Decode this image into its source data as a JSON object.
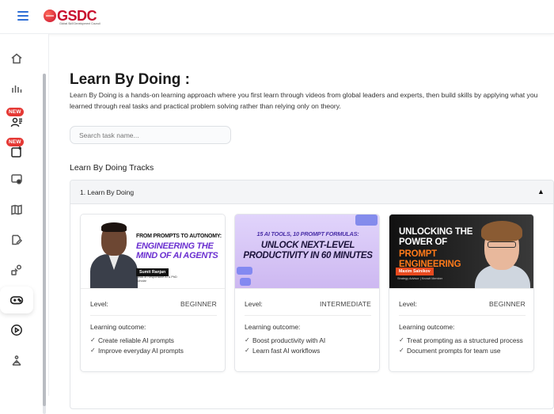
{
  "header": {
    "logo_text": "GSDC",
    "logo_sub": "Global Skill Development Council"
  },
  "sidebar": {
    "items": [
      {
        "name": "home",
        "icon": "home-icon"
      },
      {
        "name": "analytics",
        "icon": "bar-chart-icon"
      },
      {
        "name": "new-users",
        "icon": "users-icon",
        "badge": "NEW"
      },
      {
        "name": "new-add",
        "icon": "add-card-icon",
        "badge": "NEW"
      },
      {
        "name": "settings-card",
        "icon": "gear-card-icon"
      },
      {
        "name": "book",
        "icon": "book-icon"
      },
      {
        "name": "edit",
        "icon": "edit-icon"
      },
      {
        "name": "shapes",
        "icon": "shapes-icon"
      },
      {
        "name": "learn-by-doing",
        "icon": "gamepad-icon",
        "active": true
      },
      {
        "name": "video",
        "icon": "play-icon"
      },
      {
        "name": "network",
        "icon": "network-icon"
      }
    ]
  },
  "page": {
    "title": "Learn By Doing :",
    "description": "Learn By Doing is a hands-on learning approach where you first learn through videos from global leaders and experts, then build skills by applying what you learned through real tasks and practical problem solving rather than relying only on theory.",
    "search_placeholder": "Search task name...",
    "section_title": "Learn By Doing Tracks"
  },
  "accordion": {
    "title": "1. Learn By Doing",
    "arrow": "▲"
  },
  "cards": [
    {
      "thumb": {
        "line1": "FROM PROMPTS TO AUTONOMY:",
        "line2": "ENGINEERING THE MIND OF AI AGENTS",
        "badge": "Sumit Ranjan",
        "sub": "Head of Responsible AI & PhD Scholar"
      },
      "level_label": "Level:",
      "level": "BEGINNER",
      "outcome_title": "Learning outcome:",
      "outcomes": [
        "Create reliable AI prompts",
        "Improve everyday AI prompts"
      ]
    },
    {
      "thumb": {
        "line1": "15 AI TOOLS, 10 PROMPT FORMULAS:",
        "line2": "UNLOCK NEXT-LEVEL PRODUCTIVITY IN 60 MINUTES"
      },
      "level_label": "Level:",
      "level": "INTERMEDIATE",
      "outcome_title": "Learning outcome:",
      "outcomes": [
        "Boost productivity with AI",
        "Learn fast AI workflows"
      ]
    },
    {
      "thumb": {
        "line1": "UNLOCKING THE POWER OF",
        "line2": "PROMPT ENGINEERING",
        "badge": "Maxim Salnikov",
        "sub": "Strategy Advisor | Knowit Member"
      },
      "level_label": "Level:",
      "level": "BEGINNER",
      "outcome_title": "Learning outcome:",
      "outcomes": [
        "Treat prompting as a structured process",
        "Document prompts for team use"
      ]
    }
  ]
}
